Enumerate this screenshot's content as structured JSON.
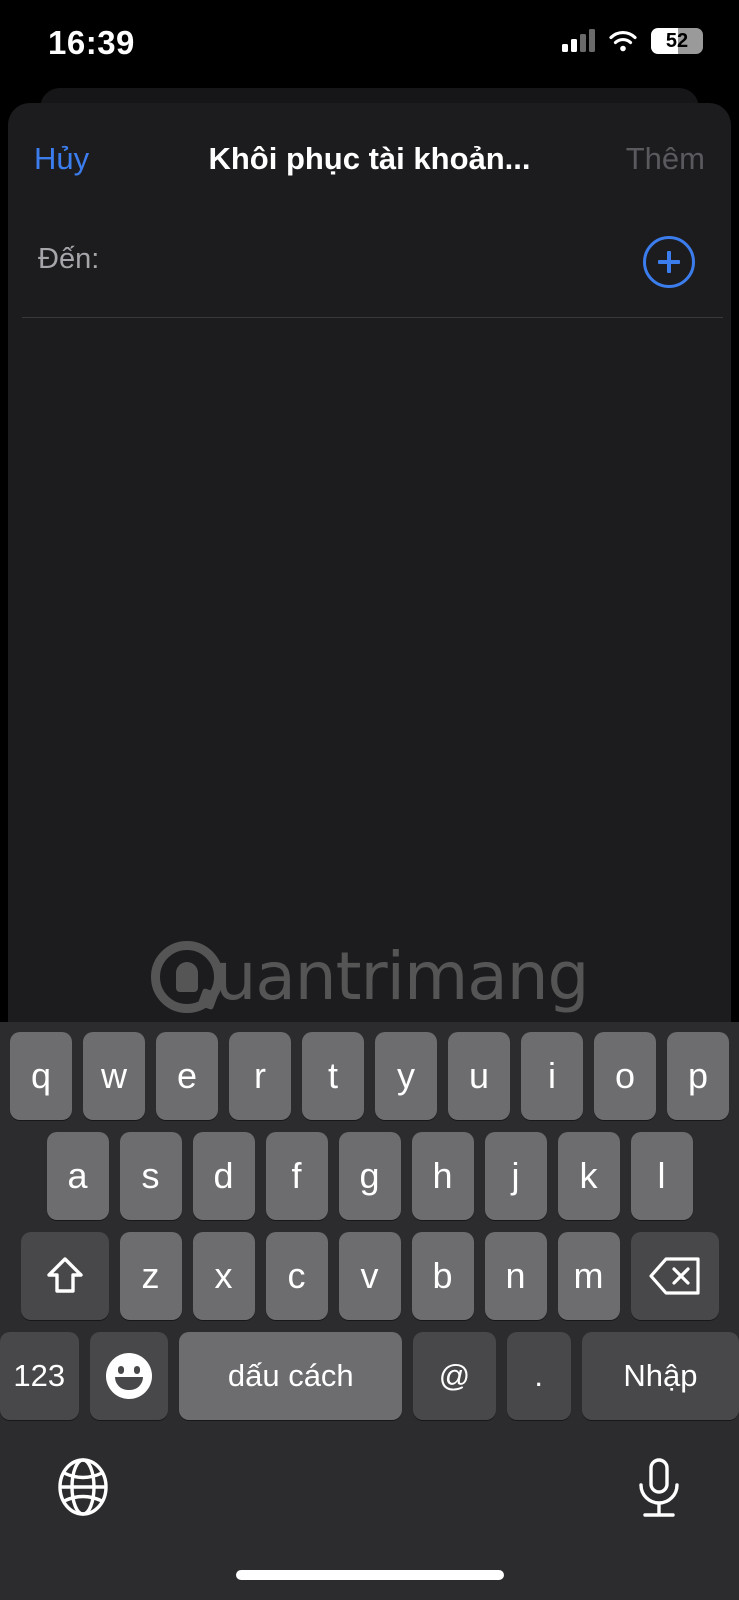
{
  "status_bar": {
    "time": "16:39",
    "cellular_icon": "cellular-bars-icon",
    "cellular_bars_active": 2,
    "wifi_icon": "wifi-icon",
    "battery_percent": "52",
    "battery_level": 52
  },
  "nav": {
    "cancel_label": "Hủy",
    "title": "Khôi phục tài khoản...",
    "add_label": "Thêm",
    "cancel_color": "#3b7ded",
    "add_color": "#5a5a5e"
  },
  "compose": {
    "to_label": "Đến:",
    "to_value": "",
    "add_contact_icon": "plus-circle-icon",
    "accent_color": "#3b7ded"
  },
  "watermark": {
    "text": "uantrimang",
    "brand": "Quantrimang",
    "logo_icon": "lightbulb-circle-icon"
  },
  "keyboard": {
    "row1": [
      "q",
      "w",
      "e",
      "r",
      "t",
      "y",
      "u",
      "i",
      "o",
      "p"
    ],
    "row2": [
      "a",
      "s",
      "d",
      "f",
      "g",
      "h",
      "j",
      "k",
      "l"
    ],
    "row3": [
      "z",
      "x",
      "c",
      "v",
      "b",
      "n",
      "m"
    ],
    "shift_icon": "shift-arrow-icon",
    "backspace_icon": "backspace-delete-icon",
    "numbers_label": "123",
    "emoji_icon": "emoji-smiley-icon",
    "space_label": "dấu cách",
    "at_label": "@",
    "period_label": ".",
    "enter_label": "Nhập",
    "globe_icon": "globe-language-icon",
    "mic_icon": "microphone-dictation-icon",
    "key_color": "#6d6d70",
    "modifier_key_color": "#48484a",
    "background_color": "#2c2c2e"
  }
}
